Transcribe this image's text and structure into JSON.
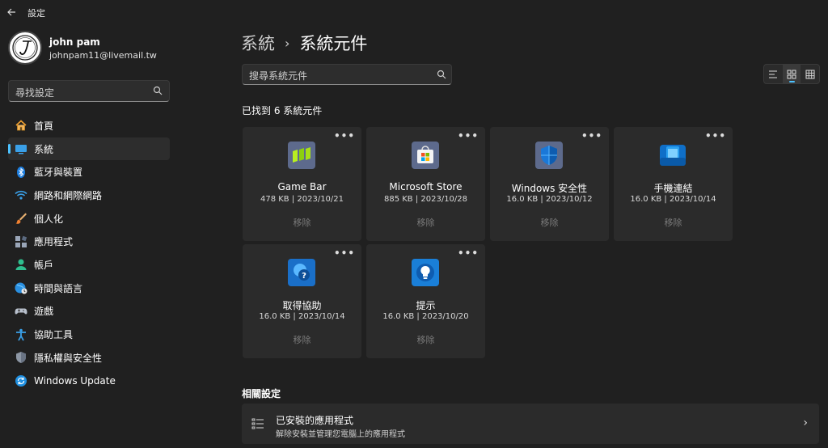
{
  "window": {
    "title": "設定"
  },
  "user": {
    "name": "john pam",
    "email": "johnpam11@livemail.tw",
    "avatar_initial": "J"
  },
  "sidebar": {
    "search_placeholder": "尋找設定",
    "items": [
      {
        "label": "首頁",
        "icon": "home-icon",
        "active": false
      },
      {
        "label": "系統",
        "icon": "system-icon",
        "active": true
      },
      {
        "label": "藍牙與裝置",
        "icon": "bluetooth-icon",
        "active": false
      },
      {
        "label": "網路和網際網路",
        "icon": "wifi-icon",
        "active": false
      },
      {
        "label": "個人化",
        "icon": "brush-icon",
        "active": false
      },
      {
        "label": "應用程式",
        "icon": "apps-icon",
        "active": false
      },
      {
        "label": "帳戶",
        "icon": "account-icon",
        "active": false
      },
      {
        "label": "時間與語言",
        "icon": "time-language-icon",
        "active": false
      },
      {
        "label": "遊戲",
        "icon": "gamepad-icon",
        "active": false
      },
      {
        "label": "協助工具",
        "icon": "accessibility-icon",
        "active": false
      },
      {
        "label": "隱私權與安全性",
        "icon": "shield-icon",
        "active": false
      },
      {
        "label": "Windows Update",
        "icon": "windows-update-icon",
        "active": false
      }
    ]
  },
  "breadcrumb": {
    "parent": "系統",
    "separator": "›",
    "current": "系統元件"
  },
  "search": {
    "placeholder": "搜尋系統元件"
  },
  "found_text": "已找到 6 系統元件",
  "more_label": "•••",
  "components": [
    {
      "name": "Game Bar",
      "meta": "478 KB | 2023/10/21",
      "action": "移除",
      "icon": "game-bar-icon"
    },
    {
      "name": "Microsoft Store",
      "meta": "885 KB | 2023/10/28",
      "action": "移除",
      "icon": "microsoft-store-icon"
    },
    {
      "name": "Windows 安全性",
      "meta": "16.0 KB | 2023/10/12",
      "action": "移除",
      "icon": "windows-security-icon"
    },
    {
      "name": "手機連結",
      "meta": "16.0 KB | 2023/10/14",
      "action": "移除",
      "icon": "phone-link-icon"
    },
    {
      "name": "取得協助",
      "meta": "16.0 KB | 2023/10/14",
      "action": "移除",
      "icon": "get-help-icon"
    },
    {
      "name": "提示",
      "meta": "16.0 KB | 2023/10/20",
      "action": "移除",
      "icon": "tips-icon"
    }
  ],
  "related": {
    "title": "相關設定",
    "item": {
      "title": "已安裝的應用程式",
      "subtitle": "解除安裝並管理您電腦上的應用程式",
      "chevron": "›"
    }
  },
  "colors": {
    "background": "#202020",
    "card": "#2b2b2b",
    "accent": "#4cc2ff"
  }
}
